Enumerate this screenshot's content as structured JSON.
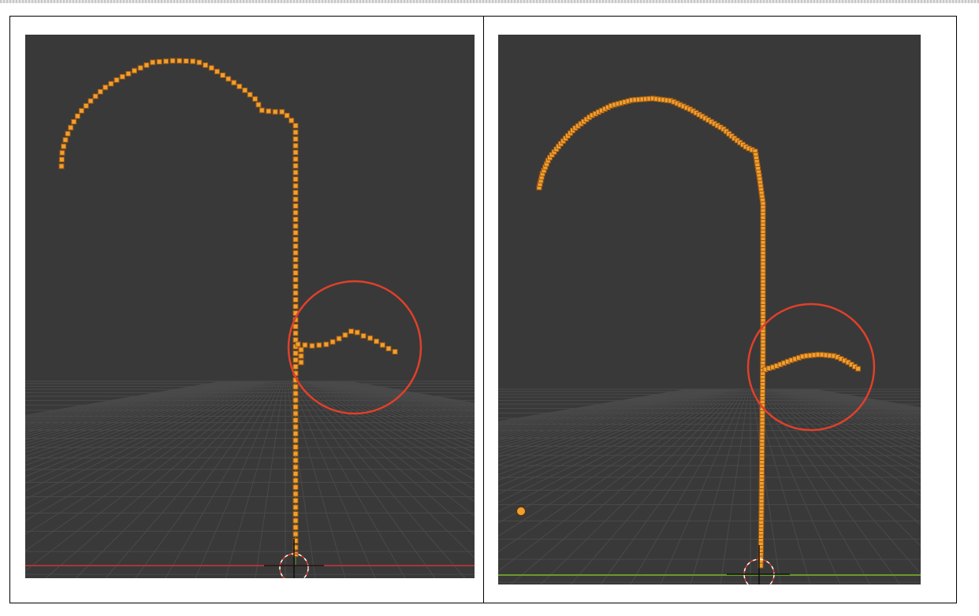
{
  "screenshots": [
    {
      "id": "left",
      "description_hidden": true
    },
    {
      "id": "right",
      "description_hidden": true
    }
  ],
  "colors": {
    "viewport_bg": "#393939",
    "grid_line": "#4a4a4a",
    "vertex_fill": "#f0a030",
    "vertex_stroke": "#a05810",
    "highlight_circle": "#e0402a",
    "x_axis": "#a8353a",
    "y_axis": "#6a9a2a",
    "cursor_ring": "#e0402a"
  },
  "icons": [
    "3d-cursor-icon",
    "origin-point-icon"
  ]
}
